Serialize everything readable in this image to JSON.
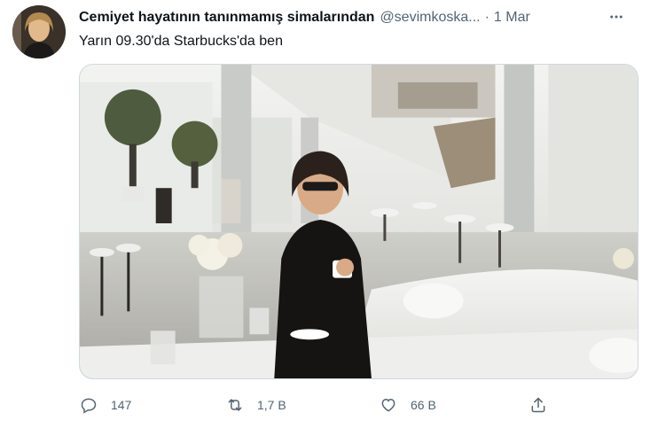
{
  "tweet": {
    "display_name": "Cemiyet hayatının tanınmamış simalarından",
    "handle": "@sevimkoska...",
    "separator": "·",
    "time": "1 Mar",
    "text": "Yarın 09.30'da Starbucks'da ben"
  },
  "media": {
    "description_icon": "photo"
  },
  "actions": {
    "reply": {
      "icon": "reply-icon",
      "count": "147"
    },
    "retweet": {
      "icon": "retweet-icon",
      "count": "1,7 B"
    },
    "like": {
      "icon": "heart-icon",
      "count": "66 B"
    },
    "share": {
      "icon": "share-icon"
    }
  },
  "colors": {
    "text_primary": "#0f1419",
    "text_secondary": "#536471",
    "border": "#cfd9de"
  }
}
